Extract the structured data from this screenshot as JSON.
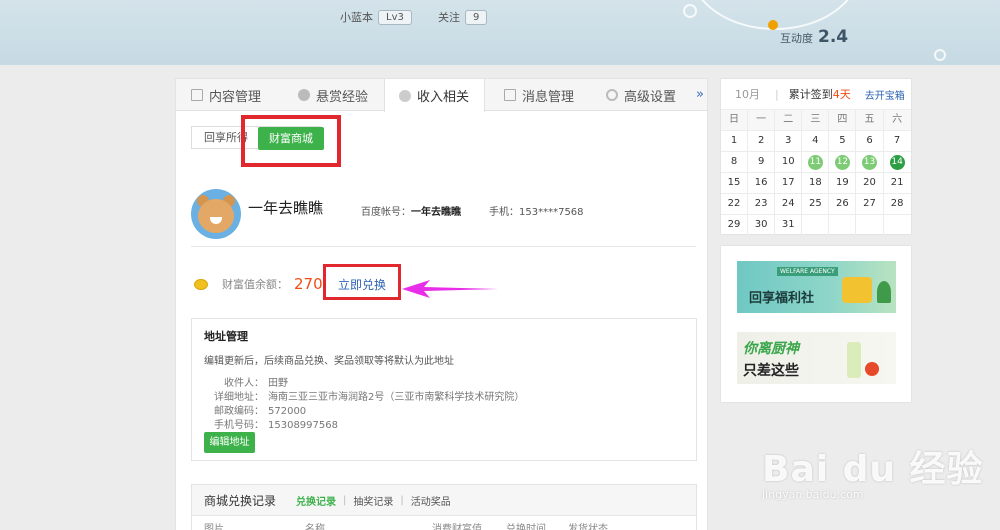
{
  "header": {
    "level_label": "小蓝本",
    "level_value": "Lv3",
    "follow_label": "关注",
    "follow_value": "9",
    "interaction_label": "互动度",
    "interaction_value": "2.4"
  },
  "tabs": [
    {
      "label": "内容管理",
      "icon": "list-icon"
    },
    {
      "label": "悬赏经验",
      "icon": "coin-icon"
    },
    {
      "label": "收入相关",
      "icon": "yen-icon"
    },
    {
      "label": "消息管理",
      "icon": "mail-icon"
    },
    {
      "label": "高级设置",
      "icon": "gear-icon"
    }
  ],
  "tab_more": "»",
  "subtabs": {
    "first": "回享所得",
    "second": "财富商城"
  },
  "profile": {
    "name": "一年去瞧瞧",
    "account_label": "百度帐号：",
    "account_value": "一年去瞧瞧",
    "phone": "手机：153****7568"
  },
  "wealth": {
    "label": "财富值余额：",
    "value": "270",
    "exchange": "立即兑换"
  },
  "address": {
    "title": "地址管理",
    "note": "编辑更新后，后续商品兑换、奖品领取等将默认为此地址",
    "rows": [
      {
        "k": "收件人：",
        "v": "田野"
      },
      {
        "k": "详细地址：",
        "v": "海南三亚三亚市海润路2号（三亚市南繁科学技术研究院）"
      },
      {
        "k": "邮政编码：",
        "v": "572000"
      },
      {
        "k": "手机号码：",
        "v": "15308997568"
      }
    ],
    "edit_button": "编辑地址"
  },
  "records": {
    "title": "商城兑换记录",
    "tabs": [
      "兑换记录",
      "抽奖记录",
      "活动奖品"
    ],
    "columns": [
      "图片",
      "名称",
      "消费财富值",
      "兑换时间",
      "发货状态"
    ]
  },
  "calendar": {
    "month": "10月",
    "sign_prefix": "累计签到",
    "sign_days": "4天",
    "treasure_link": "去开宝箱",
    "weekdays": [
      "日",
      "一",
      "二",
      "三",
      "四",
      "五",
      "六"
    ],
    "weeks": [
      [
        "1",
        "2",
        "3",
        "4",
        "5",
        "6",
        "7"
      ],
      [
        "8",
        "9",
        "10",
        "11",
        "12",
        "13",
        "14"
      ],
      [
        "15",
        "16",
        "17",
        "18",
        "19",
        "20",
        "21"
      ],
      [
        "22",
        "23",
        "24",
        "25",
        "26",
        "27",
        "28"
      ],
      [
        "29",
        "30",
        "31",
        "",
        "",
        "",
        ""
      ]
    ],
    "signed_light": [
      "11",
      "12",
      "13"
    ],
    "signed_today": "14"
  },
  "ads": {
    "ad1_tag": "WELFARE AGENCY",
    "ad1_title": "回享福利社",
    "ad2_line1": "你离厨神",
    "ad2_line2": "只差这些"
  },
  "watermark": {
    "brand": "Bai du 经验",
    "url": "jingyan.baidu.com"
  }
}
